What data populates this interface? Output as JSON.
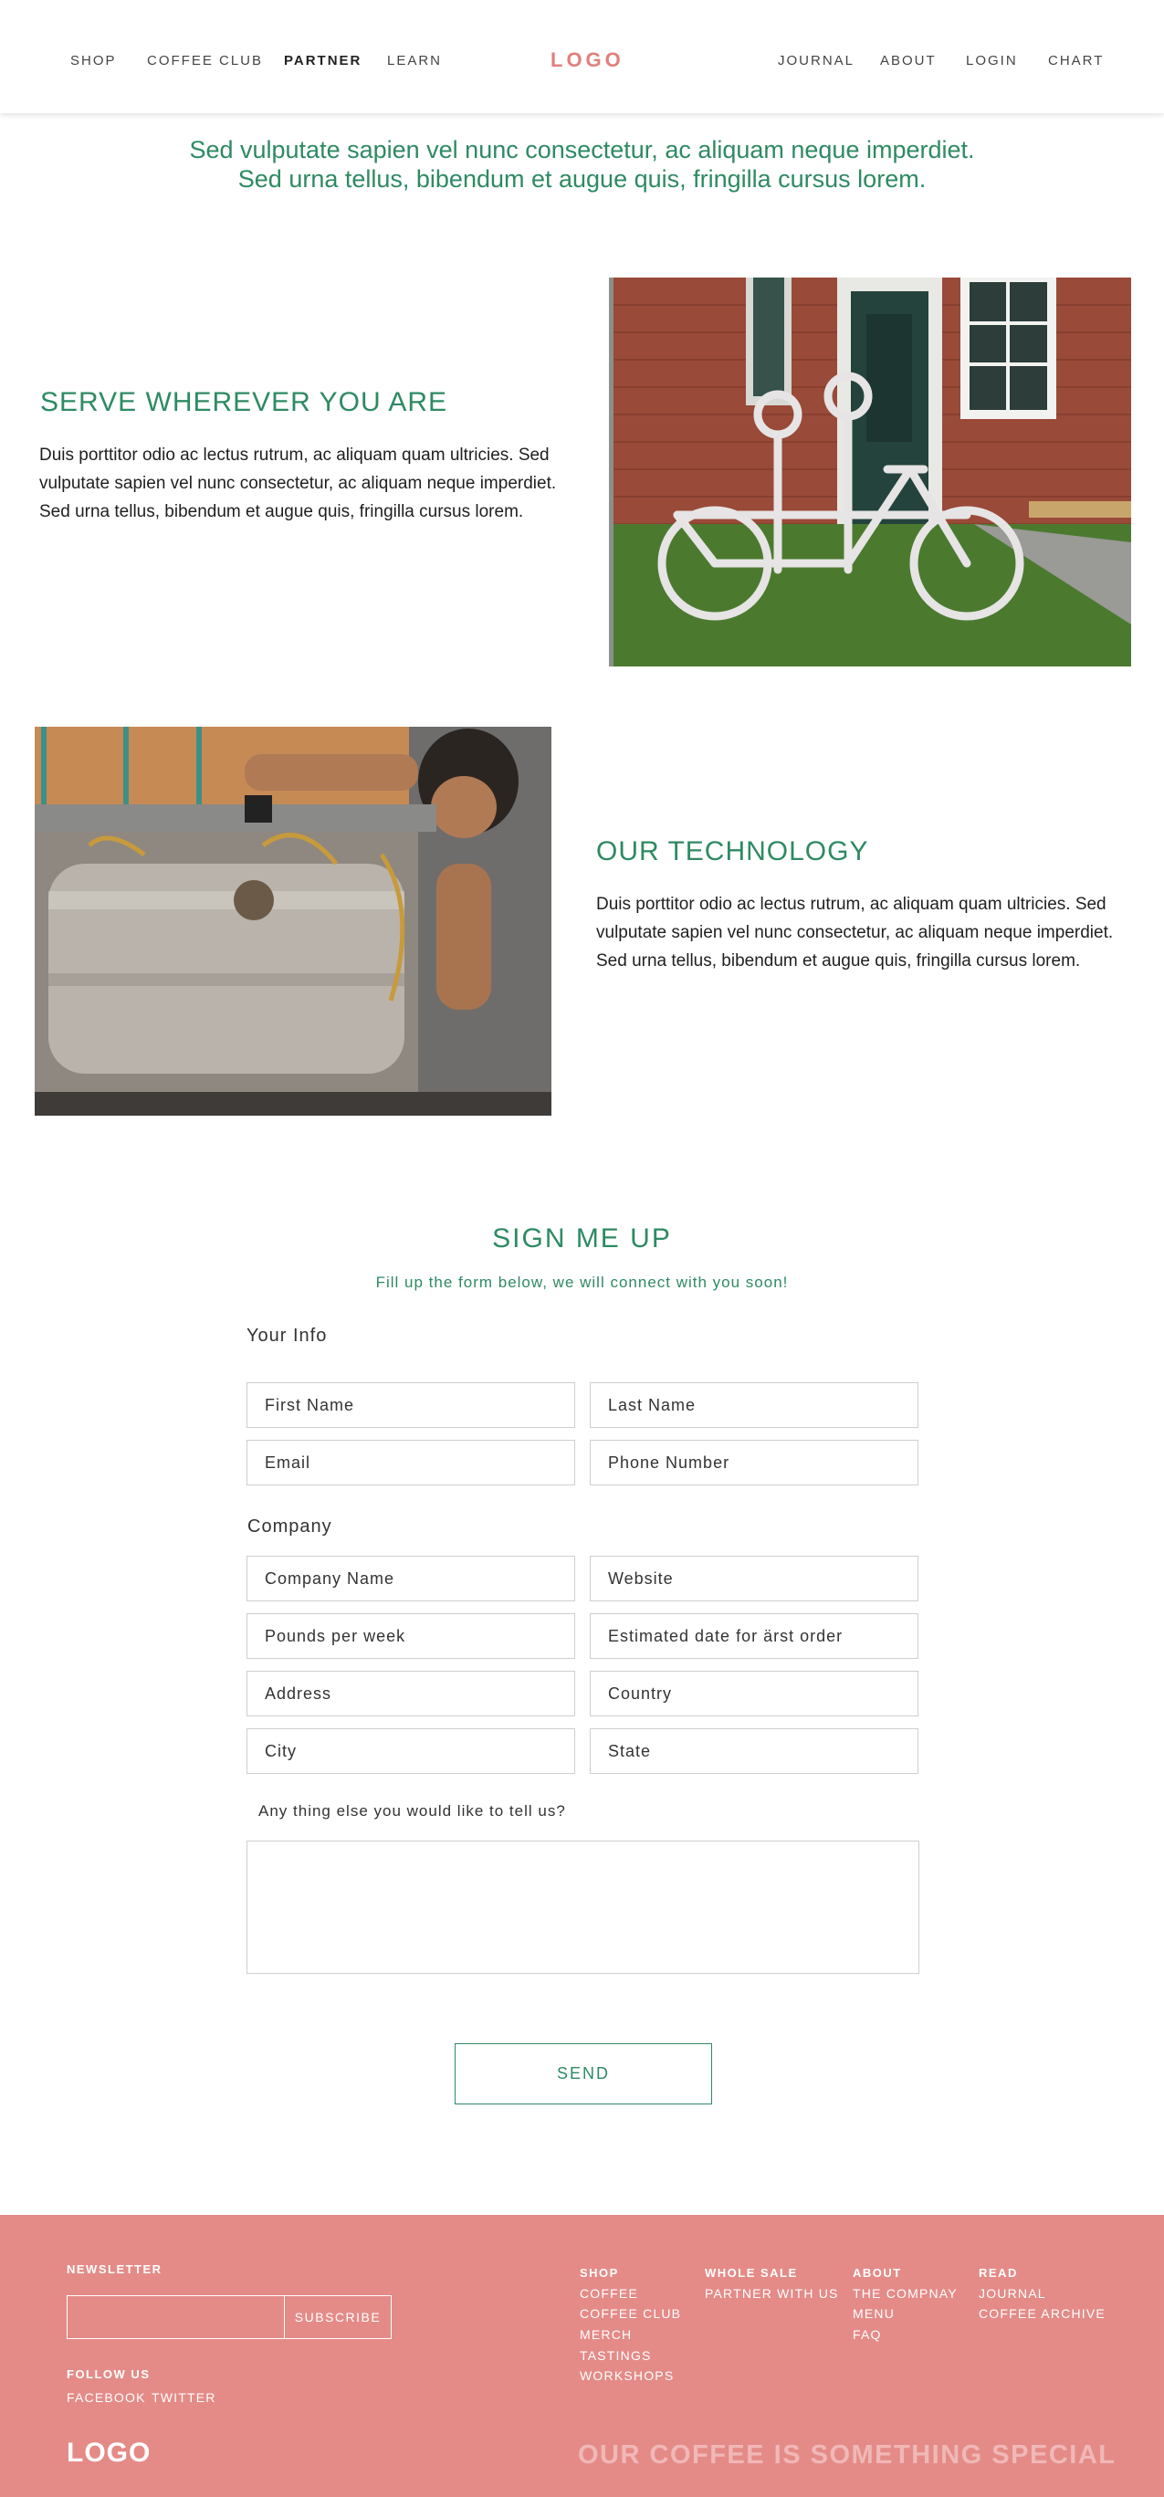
{
  "nav": {
    "left": [
      "SHOP",
      "COFFEE CLUB",
      "PARTNER",
      "LEARN"
    ],
    "logo": "LOGO",
    "right": [
      "JOURNAL",
      "ABOUT",
      "LOGIN",
      "CHART"
    ]
  },
  "intro": {
    "line1": "Sed vulputate sapien vel nunc consectetur, ac aliquam neque imperdiet.",
    "line2": "Sed urna tellus, bibendum et augue quis, fringilla cursus lorem."
  },
  "serve": {
    "title": "SERVE WHEREVER YOU ARE",
    "body": "Duis porttitor odio ac lectus rutrum, ac aliquam quam ultricies. Sed vulputate sapien vel nunc consectetur, ac aliquam neque imperdiet. Sed urna tellus, bibendum et augue quis, fringilla cursus lorem."
  },
  "technology": {
    "title": "OUR TECHNOLOGY",
    "body": "Duis porttitor odio ac lectus rutrum, ac aliquam quam ultricies. Sed vulputate sapien vel nunc consectetur, ac aliquam neque imperdiet. Sed urna tellus, bibendum et augue quis, fringilla cursus lorem."
  },
  "signup": {
    "title": "SIGN ME UP",
    "subtitle": "Fill up the form below, we will connect with you soon!",
    "your_info": "Your Info",
    "company": "Company",
    "fields": {
      "first_name": "First Name",
      "last_name": "Last Name",
      "email": "Email",
      "phone": "Phone Number",
      "company_name": "Company Name",
      "website": "Website",
      "pounds": "Pounds per week",
      "first_order": "Estimated date for ärst order",
      "address": "Address",
      "country": "Country",
      "city": "City",
      "state": "State"
    },
    "note": "Any thing else you would like to tell us?",
    "send": "SEND"
  },
  "footer": {
    "newsletter": "NEWSLETTER",
    "subscribe": "SUBSCRIBE",
    "follow": "FOLLOW US",
    "social": [
      "FACEBOOK",
      "TWITTER"
    ],
    "columns": [
      {
        "heading": "SHOP",
        "links": [
          "COFFEE",
          "COFFEE CLUB",
          "MERCH",
          "TASTINGS",
          "WORKSHOPS"
        ]
      },
      {
        "heading": "WHOLE SALE",
        "links": [
          "PARTNER WITH US"
        ]
      },
      {
        "heading": "ABOUT",
        "links": [
          "THE COMPNAY",
          "MENU",
          "FAQ"
        ]
      },
      {
        "heading": "READ",
        "links": [
          "JOURNAL",
          "COFFEE ARCHIVE"
        ]
      }
    ],
    "logo": "LOGO",
    "tagline": "OUR COFFEE IS SOMETHING SPECIAL"
  },
  "colors": {
    "accent_green": "#2e8a63",
    "logo_pink": "#e0807c",
    "footer_bg": "#e48b88"
  }
}
